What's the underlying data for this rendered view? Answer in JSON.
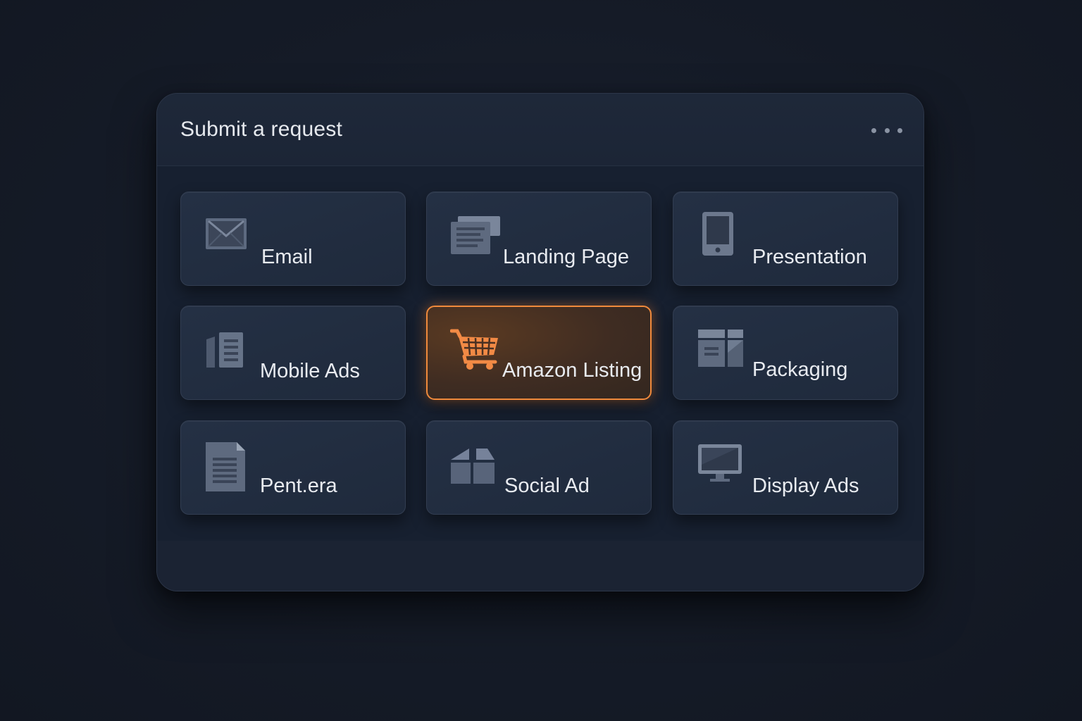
{
  "panel": {
    "title": "Submit a request",
    "more_label": "More options"
  },
  "tiles": [
    {
      "label": "Email",
      "icon": "envelope-icon"
    },
    {
      "label": "Landing Page",
      "icon": "landing-page-icon"
    },
    {
      "label": "Presentation",
      "icon": "tablet-icon"
    },
    {
      "label": "Mobile Ads",
      "icon": "mobile-ads-icon"
    },
    {
      "label": "Amazon Listing",
      "icon": "shopping-cart-icon",
      "selected": true
    },
    {
      "label": "Packaging",
      "icon": "packaging-icon"
    },
    {
      "label": "Pent.era",
      "icon": "document-icon"
    },
    {
      "label": "Social Ad",
      "icon": "social-ad-icon"
    },
    {
      "label": "Display Ads",
      "icon": "monitor-icon"
    }
  ],
  "colors": {
    "accent": "#f08a3c",
    "icon": "#6b7890",
    "text": "#e8ebf0"
  }
}
